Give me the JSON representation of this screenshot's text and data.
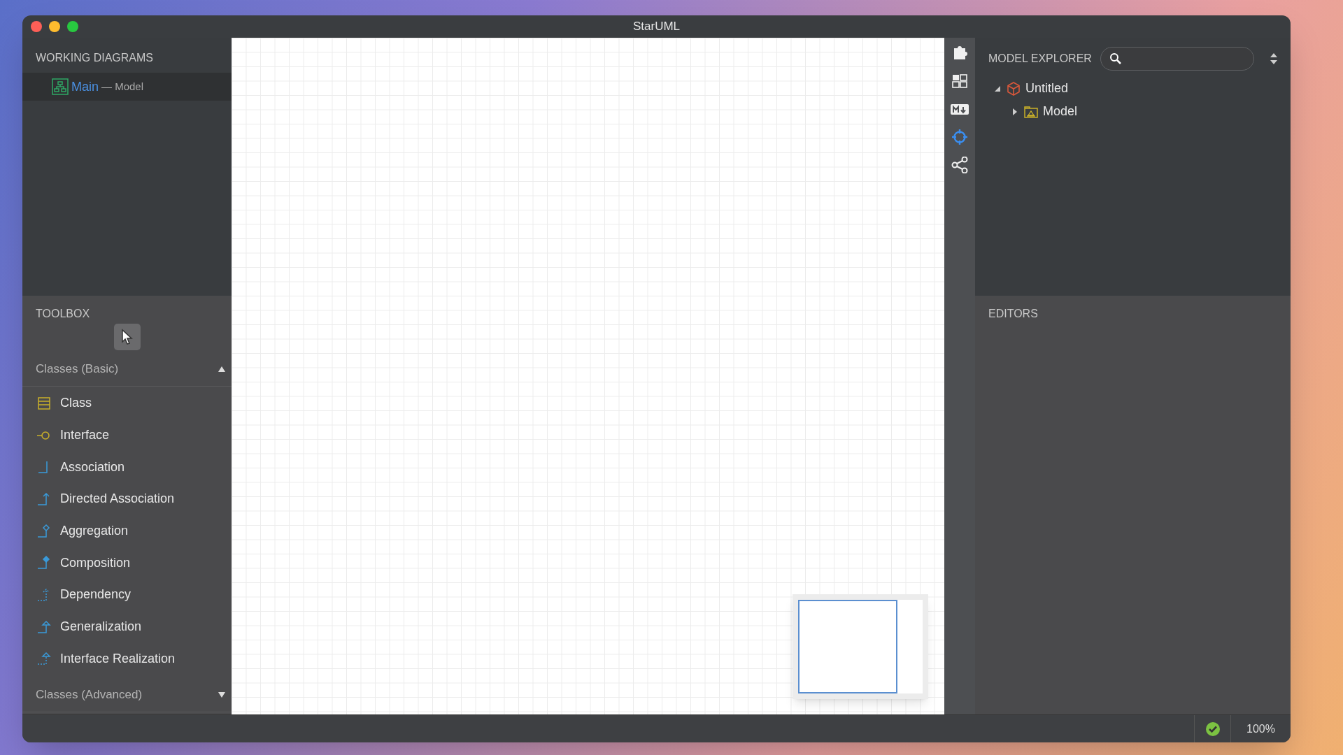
{
  "window": {
    "title": "StarUML"
  },
  "working_diagrams": {
    "title": "WORKING DIAGRAMS",
    "items": [
      {
        "name": "Main",
        "suffix": "— Model",
        "selected": true
      }
    ]
  },
  "toolbox": {
    "title": "TOOLBOX",
    "groups": [
      {
        "label": "Classes (Basic)",
        "expanded": true,
        "items": [
          {
            "label": "Class",
            "kind": "class"
          },
          {
            "label": "Interface",
            "kind": "interface"
          },
          {
            "label": "Association",
            "kind": "association"
          },
          {
            "label": "Directed Association",
            "kind": "directed"
          },
          {
            "label": "Aggregation",
            "kind": "aggregation"
          },
          {
            "label": "Composition",
            "kind": "composition"
          },
          {
            "label": "Dependency",
            "kind": "dependency"
          },
          {
            "label": "Generalization",
            "kind": "generalization"
          },
          {
            "label": "Interface Realization",
            "kind": "realization"
          }
        ]
      },
      {
        "label": "Classes (Advanced)",
        "expanded": false
      }
    ]
  },
  "side_tools": [
    {
      "kind": "extensions",
      "selected": false
    },
    {
      "kind": "layout",
      "selected": false
    },
    {
      "kind": "markdown",
      "selected": false
    },
    {
      "kind": "target",
      "selected": true
    },
    {
      "kind": "share",
      "selected": false
    }
  ],
  "model_explorer": {
    "title": "MODEL EXPLORER",
    "tree": [
      {
        "label": "Untitled",
        "kind": "project",
        "expanded": true,
        "children": [
          {
            "label": "Model",
            "kind": "model",
            "expanded": false
          }
        ]
      }
    ]
  },
  "editors": {
    "title": "EDITORS"
  },
  "status_bar": {
    "valid": true,
    "zoom": "100%"
  }
}
